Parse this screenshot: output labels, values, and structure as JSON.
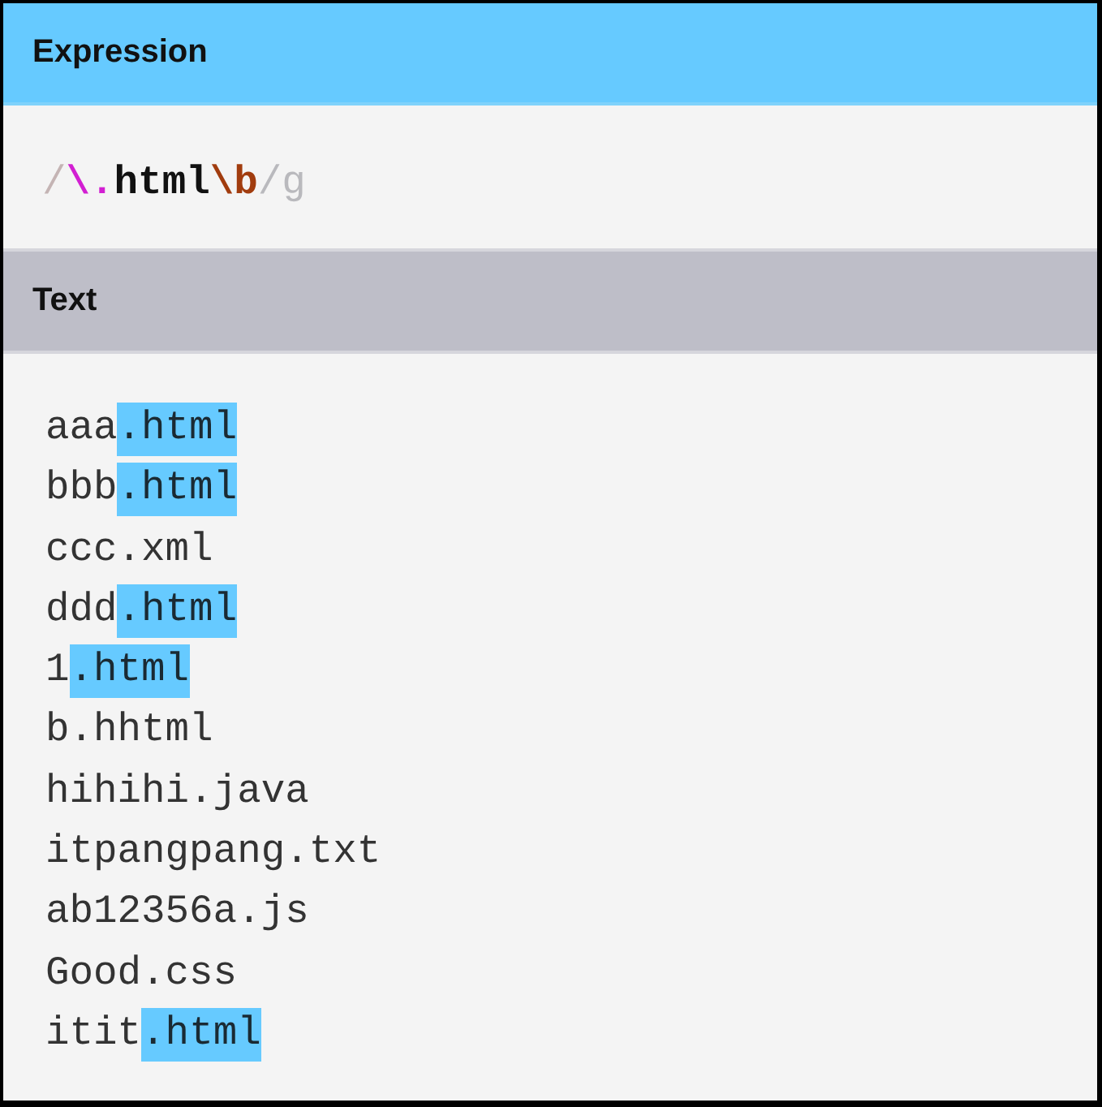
{
  "expression": {
    "title": "Expression",
    "tokens": [
      {
        "text": "/",
        "kind": "delimiter"
      },
      {
        "text": "\\.",
        "kind": "escape"
      },
      {
        "text": "html",
        "kind": "literal"
      },
      {
        "text": "\\b",
        "kind": "anchor"
      },
      {
        "text": "/g",
        "kind": "flags"
      }
    ]
  },
  "text": {
    "title": "Text",
    "lines": [
      {
        "segments": [
          {
            "text": "aaa",
            "match": false
          },
          {
            "text": ".html",
            "match": true
          }
        ]
      },
      {
        "segments": [
          {
            "text": "bbb",
            "match": false
          },
          {
            "text": ".html",
            "match": true
          }
        ]
      },
      {
        "segments": [
          {
            "text": "ccc.xml",
            "match": false
          }
        ]
      },
      {
        "segments": [
          {
            "text": "ddd",
            "match": false
          },
          {
            "text": ".html",
            "match": true
          }
        ]
      },
      {
        "segments": [
          {
            "text": "1",
            "match": false
          },
          {
            "text": ".html",
            "match": true
          }
        ]
      },
      {
        "segments": [
          {
            "text": "b.hhtml",
            "match": false
          }
        ]
      },
      {
        "segments": [
          {
            "text": "hihihi.java",
            "match": false
          }
        ]
      },
      {
        "segments": [
          {
            "text": "itpangpang.txt",
            "match": false
          }
        ]
      },
      {
        "segments": [
          {
            "text": "ab12356a.js",
            "match": false
          }
        ]
      },
      {
        "segments": [
          {
            "text": "Good.css",
            "match": false
          }
        ]
      },
      {
        "segments": [
          {
            "text": "itit",
            "match": false
          },
          {
            "text": ".html",
            "match": true
          }
        ]
      }
    ]
  }
}
